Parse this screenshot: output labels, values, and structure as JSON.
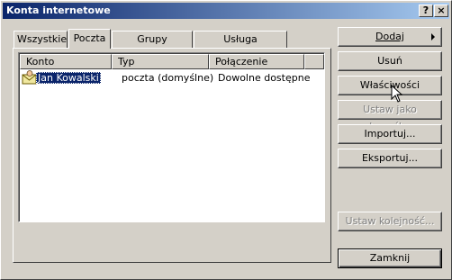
{
  "window": {
    "title": "Konta internetowe",
    "help_button": "?",
    "close_button": "×"
  },
  "tabs": [
    {
      "label": "Wszystkie",
      "active": false
    },
    {
      "label": "Poczta",
      "active": true
    },
    {
      "label": "Grupy dyskusyjne",
      "active": false
    },
    {
      "label": "Usługa katalogowa",
      "active": false
    }
  ],
  "list": {
    "columns": [
      "Konto",
      "Typ",
      "Połączenie"
    ],
    "rows": [
      {
        "account": "Jan Kowalski",
        "type": "poczta (domyślne)",
        "connection": "Dowolne dostępne",
        "selected": true
      }
    ]
  },
  "buttons": {
    "add": "Dodaj",
    "remove": "Usuń",
    "properties": "Właściwości",
    "set_default": "Ustaw jako domyślne",
    "import": "Importuj...",
    "export": "Eksportuj...",
    "set_order": "Ustaw kolejność...",
    "close": "Zamknij"
  },
  "colors": {
    "titlebar_start": "#0a246a",
    "titlebar_end": "#a6caf0",
    "selection": "#0a246a",
    "face": "#d4d0c8"
  }
}
